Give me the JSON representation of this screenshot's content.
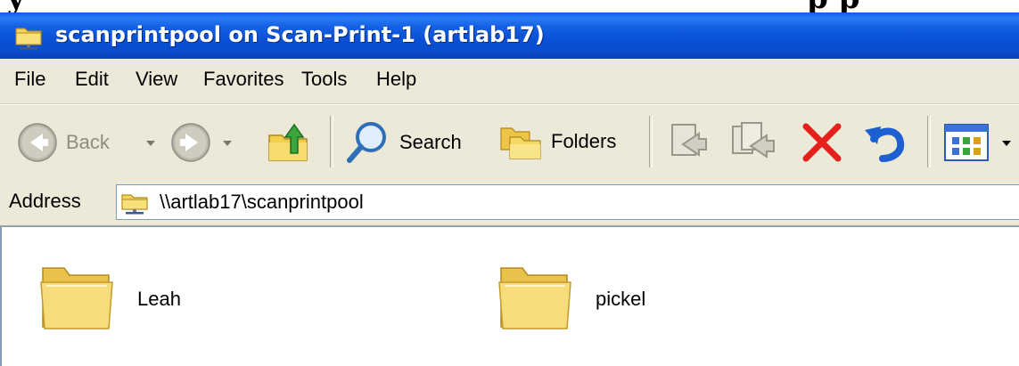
{
  "top_crop": {
    "left_text": "y",
    "right_text": "p   p"
  },
  "window": {
    "title": "scanprintpool on Scan-Print-1 (artlab17)"
  },
  "menu": [
    {
      "label": "File"
    },
    {
      "label": "Edit"
    },
    {
      "label": "View"
    },
    {
      "label": "Favorites"
    },
    {
      "label": "Tools"
    },
    {
      "label": "Help"
    }
  ],
  "toolbar": {
    "back_label": "Back",
    "search_label": "Search",
    "folders_label": "Folders"
  },
  "address": {
    "label": "Address",
    "value": "\\\\artlab17\\scanprintpool"
  },
  "folders": [
    {
      "name": "Leah"
    },
    {
      "name": "pickel"
    }
  ]
}
